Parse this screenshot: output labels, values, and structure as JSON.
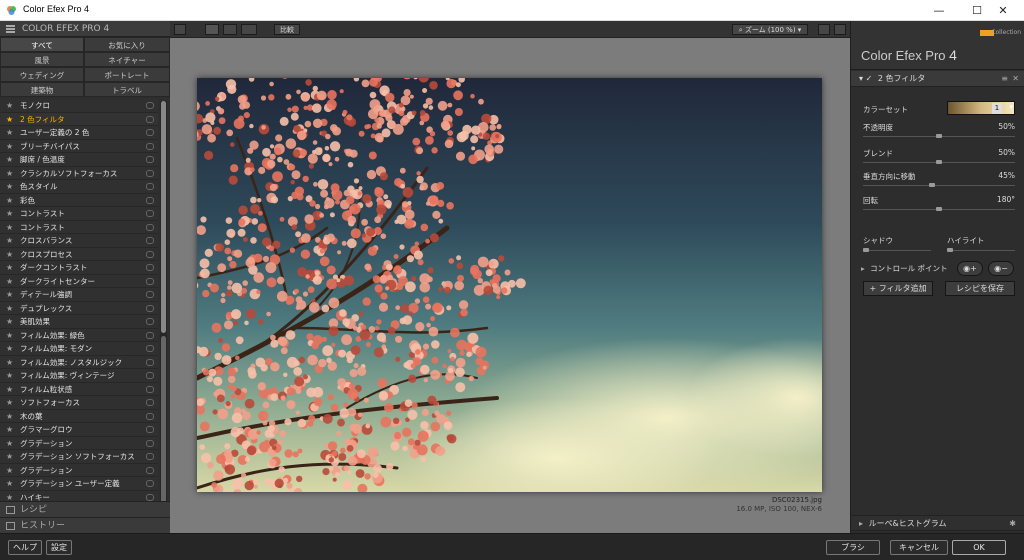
{
  "window": {
    "title": "Color Efex Pro 4",
    "minimize": "—",
    "maximize": "☐",
    "close": "✕"
  },
  "left_panel": {
    "header": "COLOR EFEX PRO 4",
    "categories": [
      {
        "label": "すべて",
        "selected": true
      },
      {
        "label": "お気に入り",
        "selected": false
      },
      {
        "label": "風景",
        "selected": false
      },
      {
        "label": "ネイチャー",
        "selected": false
      },
      {
        "label": "ウェディング",
        "selected": false
      },
      {
        "label": "ポートレート",
        "selected": false
      },
      {
        "label": "建築物",
        "selected": false
      },
      {
        "label": "トラベル",
        "selected": false
      }
    ],
    "filters": [
      "モノクロ",
      "2 色フィルタ",
      "ユーザー定義の 2 色",
      "ブリーチバイパス",
      "脚席 / 色温度",
      "クラシカルソフトフォーカス",
      "色スタイル",
      "彩色",
      "コントラスト",
      "コントラスト",
      "クロスバランス",
      "クロスプロセス",
      "ダークコントラスト",
      "ダークライトセンター",
      "ディテール強調",
      "デュプレックス",
      "美肌効果",
      "フィルム効果: 緑色",
      "フィルム効果: モダン",
      "フィルム効果: ノスタルジック",
      "フィルム効果: ヴィンテージ",
      "フィルム粒状感",
      "ソフトフォーカス",
      "木の葉",
      "グラマーグロウ",
      "グラデーション",
      "グラデーション ソフトフォーカス",
      "グラデーション",
      "グラデーション ユーザー定義",
      "ハイキー"
    ],
    "active_filter_index": 1,
    "recipes_label": "レシピ",
    "history_label": "ヒストリー"
  },
  "toolbar": {
    "compare_label": "比較",
    "zoom_label": "ズーム (100 %)"
  },
  "image": {
    "filename": "DSC02315.jpg",
    "info": "16.0 MP, ISO 100, NEX-6"
  },
  "right_panel": {
    "brand": "Color Efex Pro",
    "brand_version": "4",
    "collection_label": "Collection",
    "filter_title": "2 色フィルタ",
    "color_set_label": "カラーセット",
    "color_set_value": "1",
    "params": [
      {
        "label": "不透明度",
        "value": "50%",
        "level": 0.5
      },
      {
        "label": "ブレンド",
        "value": "50%",
        "level": 0.5
      },
      {
        "label": "垂直方向に移動",
        "value": "45%",
        "level": 0.45
      },
      {
        "label": "回転",
        "value": "180°",
        "level": 0.5
      }
    ],
    "shadow_label": "シャドウ",
    "highlight_label": "ハイライト",
    "control_points_label": "コントロール ポイント",
    "add_filter": "+ フィルタ追加",
    "save_recipe": "レシピを保存",
    "loupe_label": "ルーペ&ヒストグラム"
  },
  "bottom": {
    "help": "ヘルプ",
    "settings": "設定",
    "brush": "ブラシ",
    "cancel": "キャンセル",
    "ok": "OK"
  },
  "colors": {
    "accent": "#ffb400",
    "background": "#2b2b2b"
  }
}
